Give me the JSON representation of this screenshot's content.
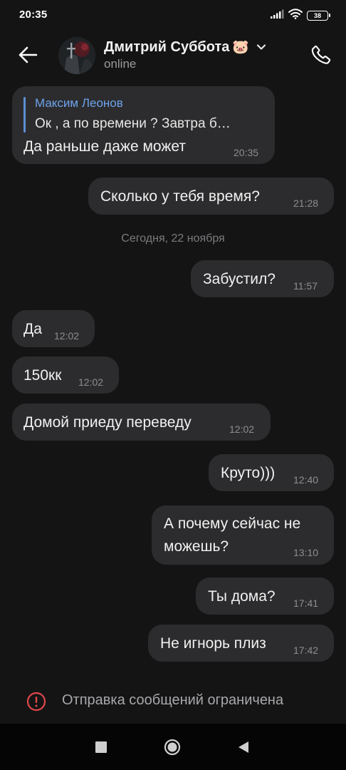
{
  "status_bar": {
    "time": "20:35",
    "signal_icon": "cellular-signal-icon",
    "wifi_icon": "wifi-icon",
    "battery": "38"
  },
  "header": {
    "back_icon": "back-arrow-icon",
    "contact_name": "Дмитрий Суббота",
    "name_emoji": "🐷",
    "dropdown_icon": "chevron-down-icon",
    "status": "online",
    "call_icon": "phone-icon"
  },
  "messages": [
    {
      "direction": "in",
      "reply": {
        "author": "Максим Леонов",
        "text": "Ок , а по времени ? Завтра б…"
      },
      "text": "Да раньше даже может",
      "time": "20:35"
    },
    {
      "direction": "out",
      "text": "Сколько у тебя время?",
      "time": "21:28"
    },
    {
      "direction": "out",
      "text": "Забустил?",
      "time": "11:57"
    },
    {
      "direction": "in",
      "text": "Да",
      "time": "12:02"
    },
    {
      "direction": "in",
      "text": "150кк",
      "time": "12:02"
    },
    {
      "direction": "in",
      "text": "Домой приеду переведу",
      "time": "12:02"
    },
    {
      "direction": "out",
      "text": "Круто)))",
      "time": "12:40"
    },
    {
      "direction": "out",
      "lines": [
        "А почему сейчас не",
        "можешь?"
      ],
      "time": "13:10"
    },
    {
      "direction": "out",
      "text": "Ты дома?",
      "time": "17:41"
    },
    {
      "direction": "out",
      "text": "Не игнорь плиз",
      "time": "17:42"
    }
  ],
  "date_separator": "Сегодня, 22 ноября",
  "restriction": {
    "icon": "alert-circle-icon",
    "text": "Отправка сообщений ограничена",
    "color": "#e0474c"
  },
  "nav_bar": {
    "recents_icon": "square-recents-icon",
    "home_icon": "circle-home-icon",
    "back_icon": "triangle-back-icon"
  },
  "colors": {
    "background": "#141414",
    "bubble": "#2c2c2e",
    "reply_accent": "#6ea3ea"
  }
}
